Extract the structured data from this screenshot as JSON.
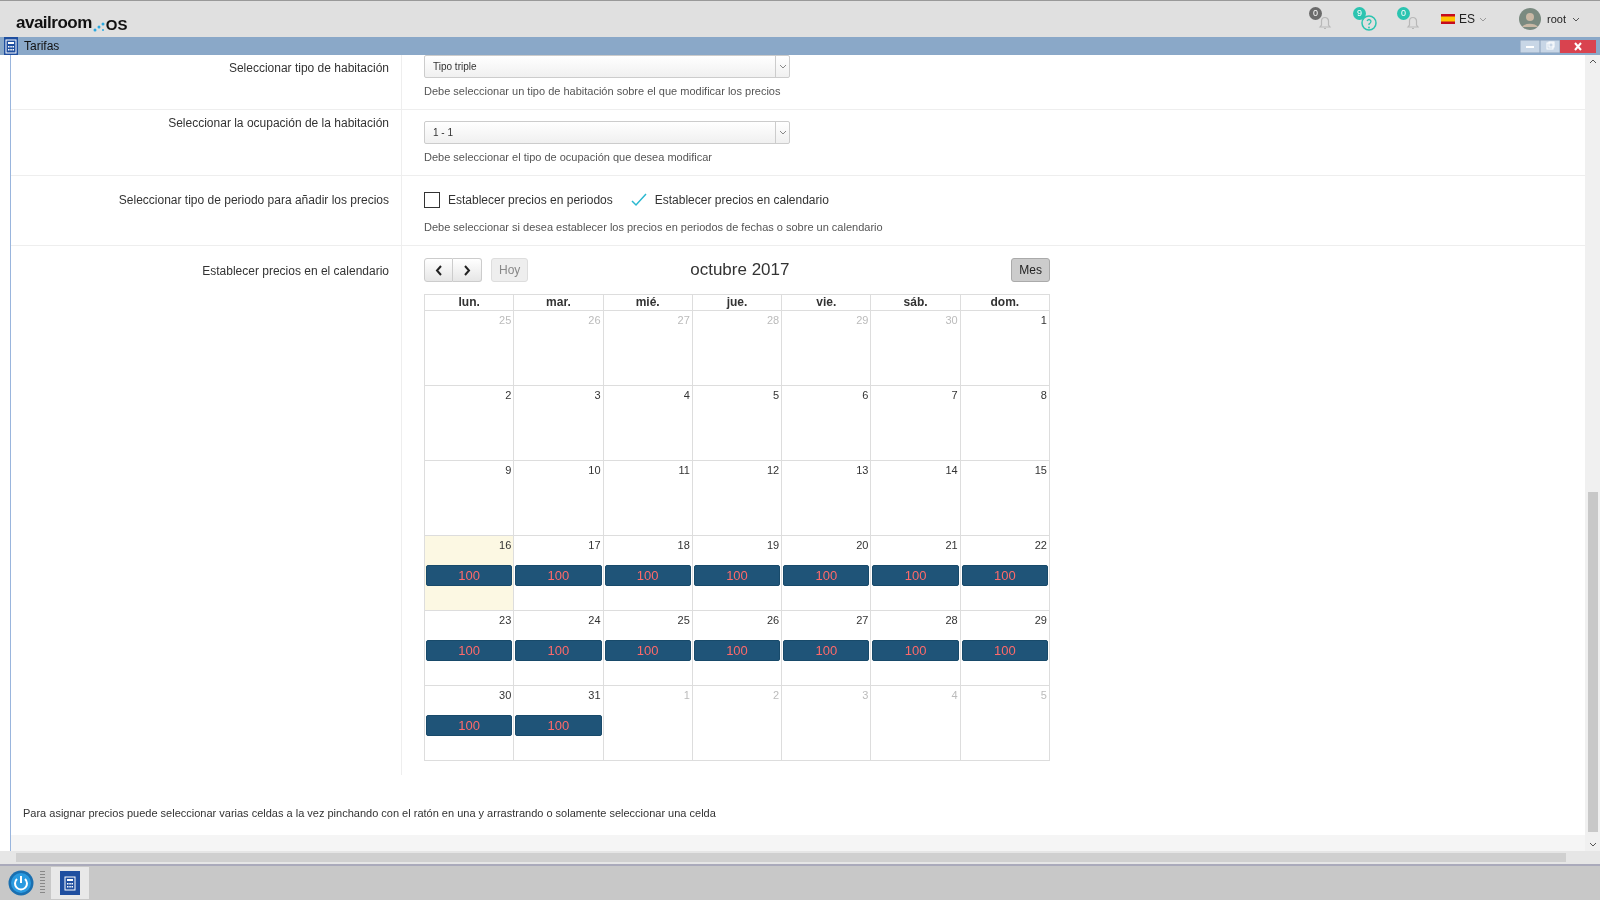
{
  "header": {
    "logo": {
      "name": "availroom",
      "suffix": "OS"
    },
    "notifications": [
      {
        "count": "0",
        "kind": "bell",
        "color": "#6b6b6b"
      },
      {
        "count": "9",
        "kind": "question",
        "color": "#2bc4b0"
      },
      {
        "count": "0",
        "kind": "bell",
        "color": "#2bc4b0"
      }
    ],
    "language": "ES",
    "user": "root"
  },
  "window": {
    "title": "Tarifas"
  },
  "form": {
    "rows": [
      {
        "label": "Seleccionar tipo de habitación",
        "kind": "select",
        "value": "Tipo triple",
        "help": "Debe seleccionar un tipo de habitación sobre el que modificar los precios"
      },
      {
        "label": "Seleccionar la ocupación de la habitación",
        "kind": "select",
        "value": "1 - 1",
        "help": "Debe seleccionar el tipo de ocupación que desea modificar"
      },
      {
        "label": "Seleccionar tipo de periodo para añadir los precios",
        "kind": "options",
        "options": [
          {
            "label": "Establecer precios en periodos",
            "checked": false
          },
          {
            "label": "Establecer precios en calendario",
            "checked": true
          }
        ],
        "help": "Debe seleccionar si desea establecer los precios en periodos de fechas o sobre un calendario"
      },
      {
        "label": "Establecer precios en el calendario",
        "kind": "calendar"
      }
    ]
  },
  "calendar": {
    "today_button": "Hoy",
    "title": "octubre 2017",
    "view_button": "Mes",
    "weekdays": [
      "lun.",
      "mar.",
      "mié.",
      "jue.",
      "vie.",
      "sáb.",
      "dom."
    ],
    "weeks": [
      [
        {
          "day": "25",
          "other_month": true,
          "today": false
        },
        {
          "day": "26",
          "other_month": true,
          "today": false
        },
        {
          "day": "27",
          "other_month": true,
          "today": false
        },
        {
          "day": "28",
          "other_month": true,
          "today": false
        },
        {
          "day": "29",
          "other_month": true,
          "today": false
        },
        {
          "day": "30",
          "other_month": true,
          "today": false
        },
        {
          "day": "1",
          "other_month": false,
          "today": false
        }
      ],
      [
        {
          "day": "2",
          "other_month": false,
          "today": false
        },
        {
          "day": "3",
          "other_month": false,
          "today": false
        },
        {
          "day": "4",
          "other_month": false,
          "today": false
        },
        {
          "day": "5",
          "other_month": false,
          "today": false
        },
        {
          "day": "6",
          "other_month": false,
          "today": false
        },
        {
          "day": "7",
          "other_month": false,
          "today": false
        },
        {
          "day": "8",
          "other_month": false,
          "today": false
        }
      ],
      [
        {
          "day": "9",
          "other_month": false,
          "today": false
        },
        {
          "day": "10",
          "other_month": false,
          "today": false
        },
        {
          "day": "11",
          "other_month": false,
          "today": false
        },
        {
          "day": "12",
          "other_month": false,
          "today": false
        },
        {
          "day": "13",
          "other_month": false,
          "today": false
        },
        {
          "day": "14",
          "other_month": false,
          "today": false
        },
        {
          "day": "15",
          "other_month": false,
          "today": false
        }
      ],
      [
        {
          "day": "16",
          "other_month": false,
          "today": true,
          "price": "100"
        },
        {
          "day": "17",
          "other_month": false,
          "today": false,
          "price": "100"
        },
        {
          "day": "18",
          "other_month": false,
          "today": false,
          "price": "100"
        },
        {
          "day": "19",
          "other_month": false,
          "today": false,
          "price": "100"
        },
        {
          "day": "20",
          "other_month": false,
          "today": false,
          "price": "100"
        },
        {
          "day": "21",
          "other_month": false,
          "today": false,
          "price": "100"
        },
        {
          "day": "22",
          "other_month": false,
          "today": false,
          "price": "100"
        }
      ],
      [
        {
          "day": "23",
          "other_month": false,
          "today": false,
          "price": "100"
        },
        {
          "day": "24",
          "other_month": false,
          "today": false,
          "price": "100"
        },
        {
          "day": "25",
          "other_month": false,
          "today": false,
          "price": "100"
        },
        {
          "day": "26",
          "other_month": false,
          "today": false,
          "price": "100"
        },
        {
          "day": "27",
          "other_month": false,
          "today": false,
          "price": "100"
        },
        {
          "day": "28",
          "other_month": false,
          "today": false,
          "price": "100"
        },
        {
          "day": "29",
          "other_month": false,
          "today": false,
          "price": "100"
        }
      ],
      [
        {
          "day": "30",
          "other_month": false,
          "today": false,
          "price": "100"
        },
        {
          "day": "31",
          "other_month": false,
          "today": false,
          "price": "100"
        },
        {
          "day": "1",
          "other_month": true,
          "today": false
        },
        {
          "day": "2",
          "other_month": true,
          "today": false
        },
        {
          "day": "3",
          "other_month": true,
          "today": false
        },
        {
          "day": "4",
          "other_month": true,
          "today": false
        },
        {
          "day": "5",
          "other_month": true,
          "today": false
        }
      ]
    ]
  },
  "footer_note": "Para asignar precios puede seleccionar varias celdas a la vez pinchando con el ratón en una y arrastrando o solamente seleccionar una celda"
}
